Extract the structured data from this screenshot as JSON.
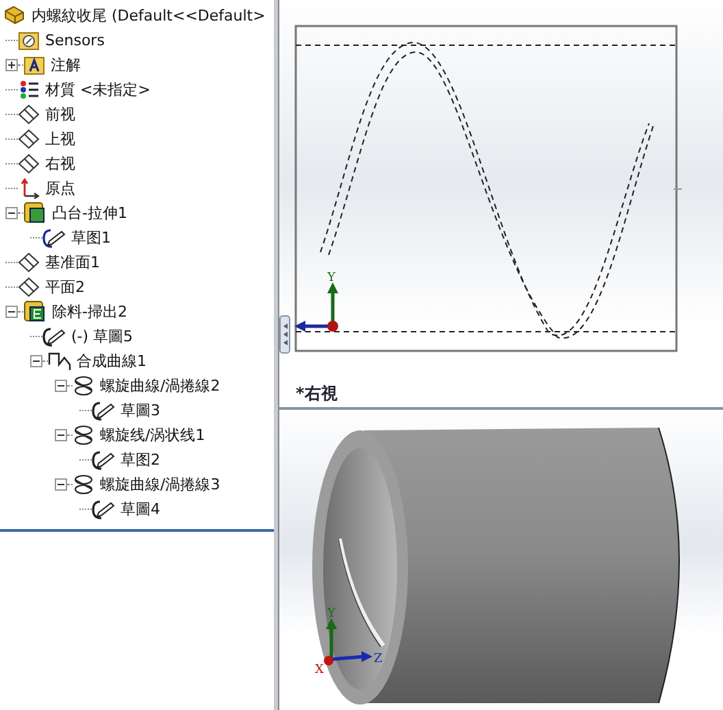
{
  "tree": {
    "label": "内螺紋收尾 (Default<<Default>",
    "kind": "part",
    "children": [
      {
        "label": "Sensors",
        "kind": "sensor-folder"
      },
      {
        "label": "注解",
        "kind": "annotation",
        "expanded": false
      },
      {
        "label": "材質 <未指定>",
        "kind": "material"
      },
      {
        "label": "前视",
        "kind": "plane"
      },
      {
        "label": "上视",
        "kind": "plane"
      },
      {
        "label": "右视",
        "kind": "plane"
      },
      {
        "label": "原点",
        "kind": "origin"
      },
      {
        "label": "凸台-拉伸1",
        "kind": "boss",
        "expanded": true,
        "children": [
          {
            "label": "草图1",
            "kind": "sketch-blue"
          }
        ]
      },
      {
        "label": "基准面1",
        "kind": "plane"
      },
      {
        "label": "平面2",
        "kind": "plane"
      },
      {
        "label": "除料-掃出2",
        "kind": "cut",
        "expanded": true,
        "children": [
          {
            "label": "(-) 草圖5",
            "kind": "sketch"
          },
          {
            "label": "合成曲線1",
            "kind": "composite-curve",
            "expanded": true,
            "children": [
              {
                "label": "螺旋曲線/渦捲線2",
                "kind": "helix",
                "expanded": true,
                "children": [
                  {
                    "label": "草圖3",
                    "kind": "sketch"
                  }
                ]
              },
              {
                "label": "螺旋线/涡状线1",
                "kind": "helix",
                "expanded": true,
                "children": [
                  {
                    "label": "草图2",
                    "kind": "sketch"
                  }
                ]
              },
              {
                "label": "螺旋曲線/渦捲線3",
                "kind": "helix",
                "expanded": true,
                "children": [
                  {
                    "label": "草圖4",
                    "kind": "sketch"
                  }
                ]
              }
            ]
          }
        ]
      }
    ]
  },
  "sketch_view": {
    "view_label": "*右視",
    "triad": {
      "y_label": "Y"
    }
  },
  "model_view": {
    "triad": {
      "y_label": "Y",
      "z_label": "Z",
      "x_label": "X"
    }
  }
}
